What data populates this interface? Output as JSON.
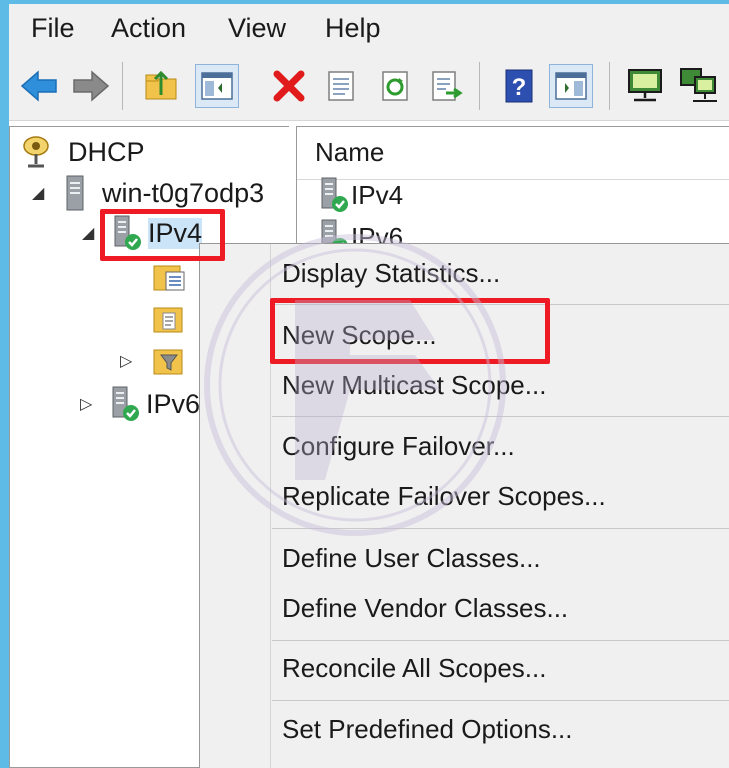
{
  "menubar": {
    "items": [
      "File",
      "Action",
      "View",
      "Help"
    ]
  },
  "toolbar": {
    "buttons": [
      "back-arrow-icon",
      "forward-arrow-icon",
      "up-folder-icon",
      "show-hide-tree-icon",
      "delete-icon",
      "properties-icon",
      "refresh-icon",
      "export-list-icon",
      "help-icon",
      "action-pane-icon",
      "monitor-icon",
      "network-icon"
    ]
  },
  "tree": {
    "root": "DHCP",
    "server": "win-t0g7odp3",
    "ipv4": "IPv4",
    "ipv6": "IPv6"
  },
  "list": {
    "header": "Name",
    "rows": [
      "IPv4",
      "IPv6"
    ]
  },
  "context_menu": {
    "items": [
      "Display Statistics...",
      "New Scope...",
      "New Multicast Scope...",
      "Configure Failover...",
      "Replicate Failover Scopes...",
      "Define User Classes...",
      "Define Vendor Classes...",
      "Reconcile All Scopes...",
      "Set Predefined Options..."
    ]
  },
  "colors": {
    "highlight": "#ee1b24",
    "accent": "#5dbbe6",
    "status_ok": "#2fa84f"
  }
}
